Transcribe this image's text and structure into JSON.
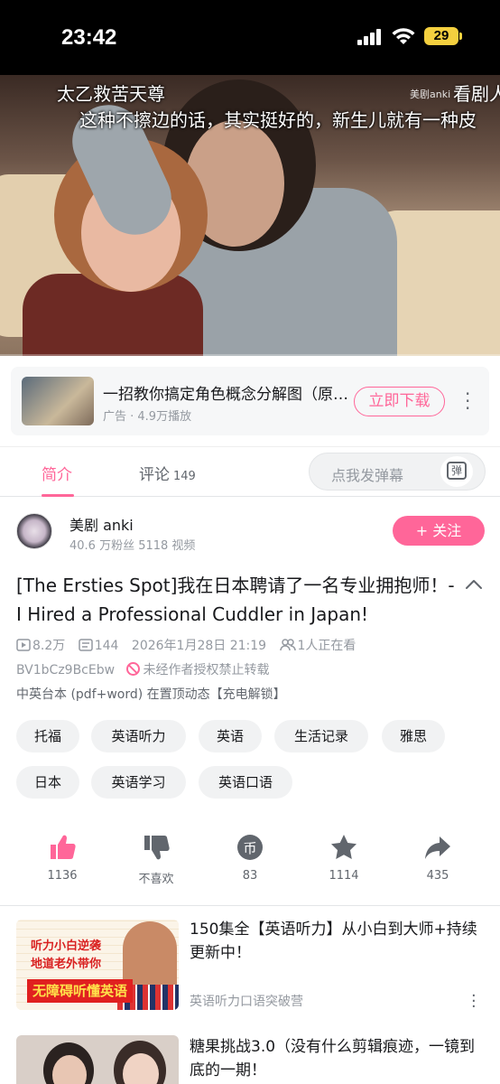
{
  "status_bar": {
    "time": "23:42",
    "battery": "29"
  },
  "video": {
    "subtitle_top": "太乙救苦天尊",
    "subtitle_main": "这种不擦边的话，其实挺好的，新生儿就有一种皮",
    "watermark": "美剧anki",
    "corner_text": "看剧人"
  },
  "ad": {
    "title": "一招教你搞定角色概念分解图（原画人员",
    "meta": "广告 · 4.9万播放",
    "cta": "立即下载"
  },
  "tabs": {
    "intro": "简介",
    "comments": "评论",
    "comments_count": "149",
    "danmaku_placeholder": "点我发弹幕",
    "danmaku_button": "弹"
  },
  "uploader": {
    "name": "美剧 anki",
    "stats": "40.6 万粉丝  5118 视频",
    "follow": "+ 关注"
  },
  "video_info": {
    "title": "[The Ersties Spot]我在日本聘请了一名专业拥抱师！-I Hired a Professional Cuddler in Japan!",
    "views": "8.2万",
    "danmaku_count": "144",
    "date": "2026年1月28日 21:19",
    "watching": "1人正在看",
    "bvid": "BV1bCz9BcEbw",
    "no_repost": "未经作者授权禁止转载",
    "description": "中英台本 (pdf+word) 在置顶动态【充电解锁】"
  },
  "tags": [
    "托福",
    "英语听力",
    "英语",
    "生活记录",
    "雅思",
    "日本",
    "英语学习",
    "英语口语"
  ],
  "actions": {
    "like": "1136",
    "dislike": "不喜欢",
    "coin": "83",
    "favorite": "1114",
    "share": "435"
  },
  "recommendations": [
    {
      "title": "150集全【英语听力】从小白到大师+持续更新中！",
      "author": "英语听力口语突破营",
      "thumb_line1": "听力小白逆袭",
      "thumb_line2": "地道老外带你",
      "thumb_line3": "无障碍听懂英语"
    },
    {
      "title": "糖果挑战3.0（没有什么剪辑痕迹，一镜到底的一期！"
    }
  ],
  "colors": {
    "accent": "#ff6699",
    "text": "#18191c",
    "secondary": "#9499a0"
  }
}
